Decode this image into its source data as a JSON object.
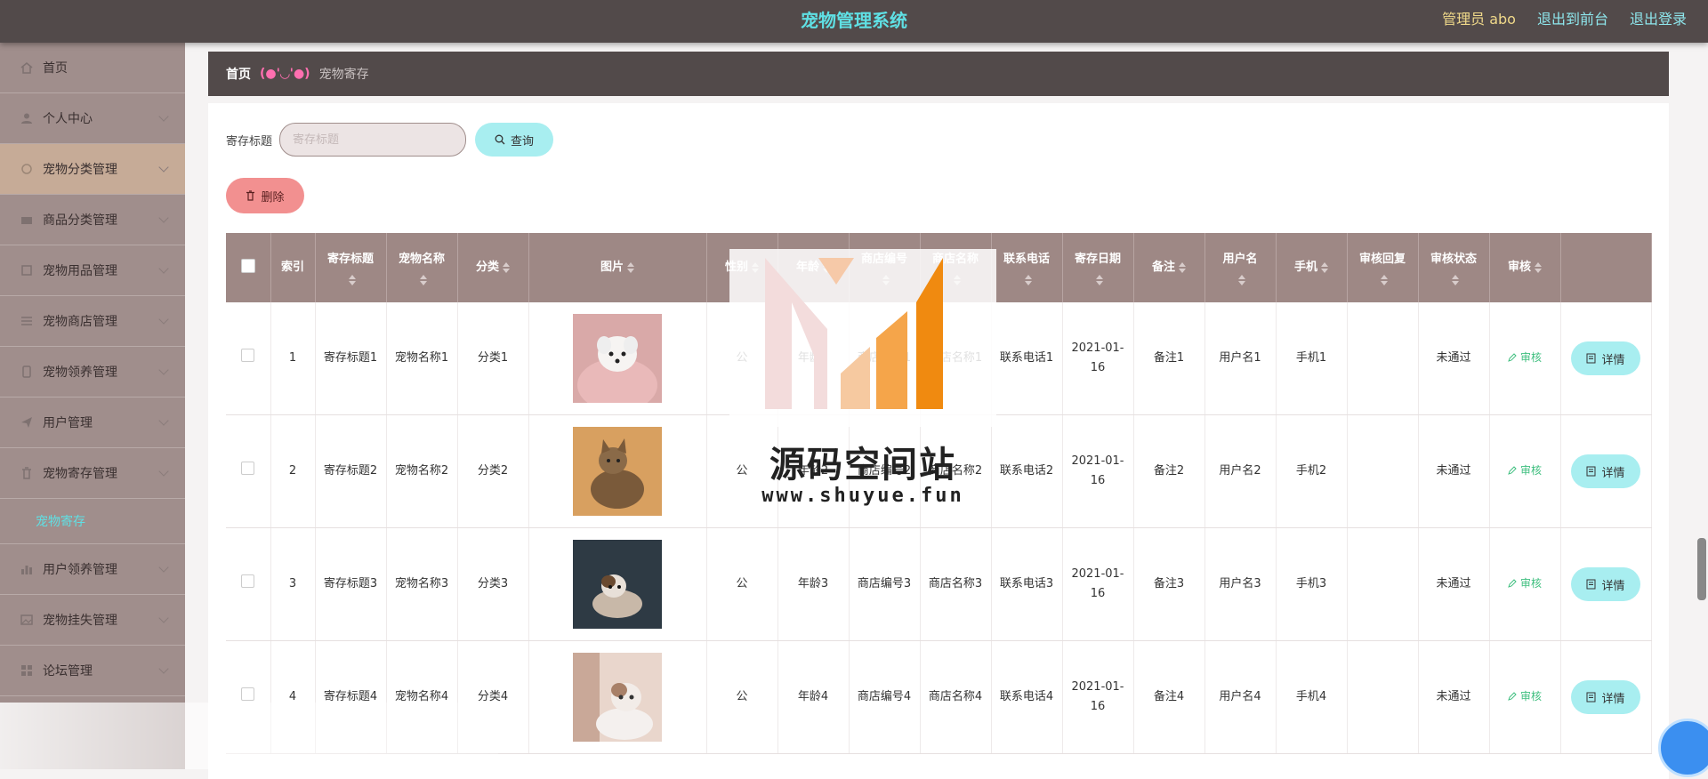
{
  "header": {
    "title": "宠物管理系统",
    "admin_label": "管理员 abo",
    "back_front": "退出到前台",
    "logout": "退出登录"
  },
  "sidebar": {
    "items": [
      {
        "label": "首页",
        "icon": "home-icon"
      },
      {
        "label": "个人中心",
        "icon": "user-icon"
      },
      {
        "label": "宠物分类管理",
        "icon": "category-icon"
      },
      {
        "label": "商品分类管理",
        "icon": "tag-icon"
      },
      {
        "label": "宠物用品管理",
        "icon": "box-icon"
      },
      {
        "label": "宠物商店管理",
        "icon": "list-icon"
      },
      {
        "label": "宠物领养管理",
        "icon": "phone-icon"
      },
      {
        "label": "用户管理",
        "icon": "send-icon"
      },
      {
        "label": "宠物寄存管理",
        "icon": "trash-icon"
      },
      {
        "label": "用户领养管理",
        "icon": "chart-icon"
      },
      {
        "label": "宠物挂失管理",
        "icon": "image-icon"
      },
      {
        "label": "论坛管理",
        "icon": "grid-icon"
      }
    ],
    "submenu_active": "宠物寄存"
  },
  "breadcrumb": {
    "home": "首页",
    "separator": "(●'◡'●)",
    "current": "宠物寄存"
  },
  "search": {
    "label": "寄存标题",
    "placeholder": "寄存标题",
    "query_button": "查询"
  },
  "toolbar": {
    "delete_button": "删除"
  },
  "table": {
    "columns": [
      "索引",
      "寄存标题",
      "宠物名称",
      "分类",
      "图片",
      "性别",
      "年龄",
      "商店编号",
      "商店名称",
      "联系电话",
      "寄存日期",
      "备注",
      "用户名",
      "手机",
      "审核回复",
      "审核状态",
      "审核"
    ],
    "rows": [
      {
        "index": "1",
        "title": "寄存标题1",
        "pet": "宠物名称1",
        "cat": "分类1",
        "sex": "公",
        "age": "年龄1",
        "shop_no": "商店编号1",
        "shop_name": "商店名称1",
        "phone": "联系电话1",
        "date": "2021-01-16",
        "note": "备注1",
        "user": "用户名1",
        "mobile": "手机1",
        "reply": "",
        "status": "未通过",
        "audit": "审核",
        "detail": "详情"
      },
      {
        "index": "2",
        "title": "寄存标题2",
        "pet": "宠物名称2",
        "cat": "分类2",
        "sex": "公",
        "age": "年龄2",
        "shop_no": "商店编号2",
        "shop_name": "商店名称2",
        "phone": "联系电话2",
        "date": "2021-01-16",
        "note": "备注2",
        "user": "用户名2",
        "mobile": "手机2",
        "reply": "",
        "status": "未通过",
        "audit": "审核",
        "detail": "详情"
      },
      {
        "index": "3",
        "title": "寄存标题3",
        "pet": "宠物名称3",
        "cat": "分类3",
        "sex": "公",
        "age": "年龄3",
        "shop_no": "商店编号3",
        "shop_name": "商店名称3",
        "phone": "联系电话3",
        "date": "2021-01-16",
        "note": "备注3",
        "user": "用户名3",
        "mobile": "手机3",
        "reply": "",
        "status": "未通过",
        "audit": "审核",
        "detail": "详情"
      },
      {
        "index": "4",
        "title": "寄存标题4",
        "pet": "宠物名称4",
        "cat": "分类4",
        "sex": "公",
        "age": "年龄4",
        "shop_no": "商店编号4",
        "shop_name": "商店名称4",
        "phone": "联系电话4",
        "date": "2021-01-16",
        "note": "备注4",
        "user": "用户名4",
        "mobile": "手机4",
        "reply": "",
        "status": "未通过",
        "audit": "审核",
        "detail": "详情"
      }
    ]
  },
  "watermark": {
    "name": "源码空间站",
    "url": "www.shuyue.fun"
  },
  "colors": {
    "topbar": "#524a4a",
    "sidebar": "#a08e8c",
    "accent": "#5fe0e4",
    "table_header": "#9e8885",
    "delete": "#f29090"
  }
}
